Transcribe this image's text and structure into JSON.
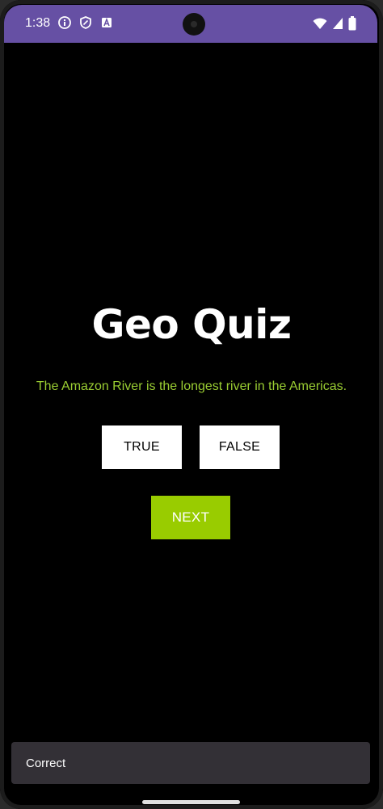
{
  "colors": {
    "status_bar": "#6650a4",
    "question_text": "#9acd32",
    "next_button": "#99cc00",
    "background": "#000000"
  },
  "status_bar": {
    "time": "1:38",
    "left_icons": [
      "info-icon",
      "shield-icon",
      "font-icon"
    ],
    "right_icons": [
      "wifi-icon",
      "signal-icon",
      "battery-icon"
    ]
  },
  "quiz": {
    "title": "Geo Quiz",
    "question": "The Amazon River is the longest river in the Americas.",
    "true_label": "TRUE",
    "false_label": "FALSE",
    "next_label": "NEXT"
  },
  "snackbar": {
    "message": "Correct"
  }
}
